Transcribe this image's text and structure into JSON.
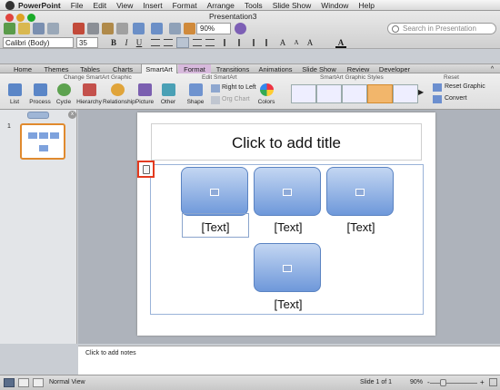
{
  "menu_bar": {
    "app_name": "PowerPoint",
    "items": [
      "File",
      "Edit",
      "View",
      "Insert",
      "Format",
      "Arrange",
      "Tools",
      "Slide Show",
      "Window",
      "Help"
    ]
  },
  "window": {
    "title": "Presentation3"
  },
  "toolbar": {
    "zoom_value": "90%",
    "search_placeholder": "Search in Presentation",
    "font_name": "Calibri (Body)",
    "font_size": "35"
  },
  "ribbon": {
    "tabs": [
      "Home",
      "Themes",
      "Tables",
      "Charts",
      "SmartArt",
      "Format",
      "Transitions",
      "Animations",
      "Slide Show",
      "Review",
      "Developer"
    ],
    "active_tab": "SmartArt",
    "groups": {
      "change_graphic": "Change SmartArt Graphic",
      "edit": "Edit SmartArt",
      "styles": "SmartArt Graphic Styles",
      "reset": "Reset"
    },
    "buttons": {
      "list": "List",
      "process": "Process",
      "cycle": "Cycle",
      "hierarchy": "Hierarchy",
      "relationship": "Relationship",
      "picture": "Picture",
      "other": "Other",
      "shape": "Shape",
      "right_to_left": "Right to Left",
      "org_chart": "Org Chart",
      "colors": "Colors",
      "reset_graphic": "Reset Graphic",
      "convert": "Convert"
    }
  },
  "slides_pane": {
    "slide_number": "1"
  },
  "slide": {
    "title_placeholder": "Click to add title",
    "smartart_texts": [
      "[Text]",
      "[Text]",
      "[Text]",
      "[Text]"
    ]
  },
  "notes": {
    "placeholder": "Click to add notes"
  },
  "status_bar": {
    "view_name": "Normal View",
    "slide_position": "Slide 1 of 1",
    "zoom": "90%"
  },
  "colors": {
    "highlight": "#e33a1f",
    "shape_fill": "#7ea2dd",
    "thumbnail_border": "#e08a2e"
  }
}
